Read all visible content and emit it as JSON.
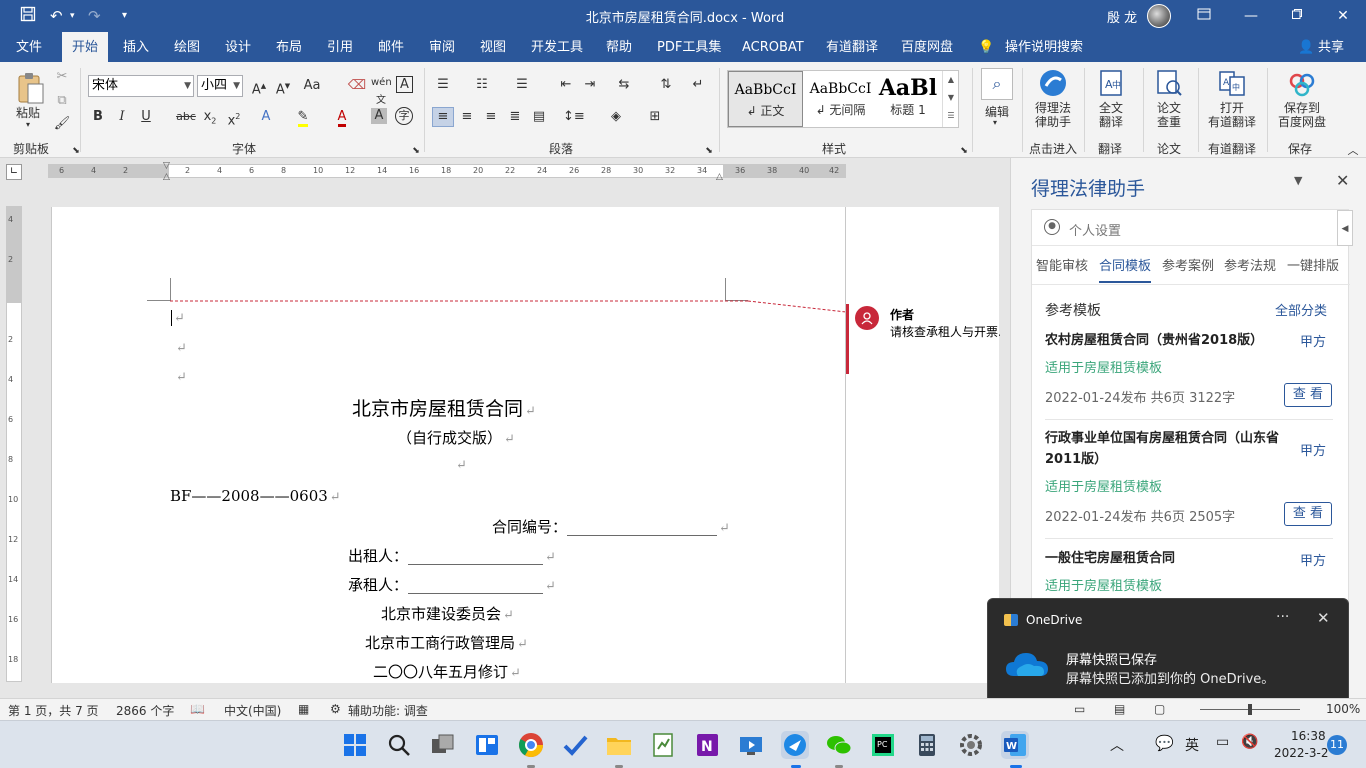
{
  "window": {
    "title": "北京市房屋租赁合同.docx  -  Word",
    "user": "殷 龙",
    "qa_save_icon": "save-icon",
    "qa_undo_icon": "undo-icon",
    "qa_redo_icon": "redo-icon",
    "qa_customize": "▾"
  },
  "tabs": [
    "文件",
    "开始",
    "插入",
    "绘图",
    "设计",
    "布局",
    "引用",
    "邮件",
    "审阅",
    "视图",
    "开发工具",
    "帮助",
    "PDF工具集",
    "ACROBAT",
    "有道翻译",
    "百度网盘"
  ],
  "tell_me": "操作说明搜索",
  "share": "共享",
  "ribbon": {
    "clipboard": {
      "paste": "粘贴",
      "label": "剪贴板"
    },
    "font": {
      "name": "宋体",
      "size": "小四",
      "label": "字体"
    },
    "paragraph": {
      "label": "段落"
    },
    "styles": {
      "label": "样式",
      "items": [
        {
          "preview": "AaBbCcI",
          "name": "↲ 正文"
        },
        {
          "preview": "AaBbCcI",
          "name": "↲ 无间隔"
        },
        {
          "preview": "AaBl",
          "name": "标题 1"
        }
      ]
    },
    "editing": {
      "label": "编辑"
    },
    "addins": [
      {
        "name": "得理法\n律助手",
        "group": "点击进入"
      },
      {
        "name": "全文\n翻译",
        "group": "翻译"
      },
      {
        "name": "论文\n查重",
        "group": "论文"
      },
      {
        "name": "打开\n有道翻译",
        "group": "有道翻译"
      },
      {
        "name": "保存到\n百度网盘",
        "group": "保存"
      }
    ]
  },
  "ruler_h": [
    "6",
    "4",
    "2",
    "2",
    "4",
    "6",
    "8",
    "10",
    "12",
    "14",
    "16",
    "18",
    "20",
    "22",
    "24",
    "26",
    "28",
    "30",
    "32",
    "34",
    "36",
    "38",
    "40",
    "42"
  ],
  "ruler_v": [
    "4",
    "2",
    "",
    "2",
    "4",
    "6",
    "8",
    "10",
    "12",
    "14",
    "16",
    "18"
  ],
  "document": {
    "title": "北京市房屋租赁合同",
    "subtitle": "（自行成交版）",
    "code": "BF——2008——0603",
    "contract_no": "合同编号：",
    "lessor": "出租人：",
    "lessee": "承租人：",
    "org1": "北京市建设委员会",
    "org2": "北京市工商行政管理局",
    "revised": "二〇〇八年五月修订",
    "para_mark": "↵",
    "blank_long": "____________________",
    "blank_short": "__________________"
  },
  "comment": {
    "author": "作者",
    "text": "请核查承租人与开票..."
  },
  "pane": {
    "title": "得理法律助手",
    "settings": "个人设置",
    "tabs": [
      "智能审核",
      "合同模板",
      "参考案例",
      "参考法规",
      "一键排版"
    ],
    "active_tab": "合同模板",
    "section_title": "参考模板",
    "section_all": "全部分类",
    "cards": [
      {
        "title": "农村房屋租赁合同（贵州省2018版）",
        "party": "甲方",
        "tag": "适用于房屋租赁模板",
        "meta": "2022-01-24发布 共6页 3122字",
        "button": "查 看"
      },
      {
        "title": "行政事业单位国有房屋租赁合同（山东省2011版）",
        "party": "甲方",
        "tag": "适用于房屋租赁模板",
        "meta": "2022-01-24发布 共6页 2505字",
        "button": "查 看"
      },
      {
        "title": "一般住宅房屋租赁合同",
        "party": "甲方",
        "tag": "适用于房屋租赁模板",
        "meta": "",
        "button": ""
      }
    ]
  },
  "toast": {
    "app": "OneDrive",
    "title": "屏幕快照已保存",
    "body": "屏幕快照已添加到你的 OneDrive。",
    "more": "···",
    "close": "✕"
  },
  "status": {
    "page": "第 1 页，共 7 页",
    "words": "2866 个字",
    "lang": "中文(中国)",
    "accessibility": "辅助功能: 调查",
    "zoom": "100%"
  },
  "taskbar": {
    "lang": "英",
    "time": "16:38",
    "date": "2022-3-2",
    "notifications": "11"
  },
  "colors": {
    "word_blue": "#2b579a",
    "comment_red": "#c8283a",
    "tag_green": "#3aa57a"
  }
}
